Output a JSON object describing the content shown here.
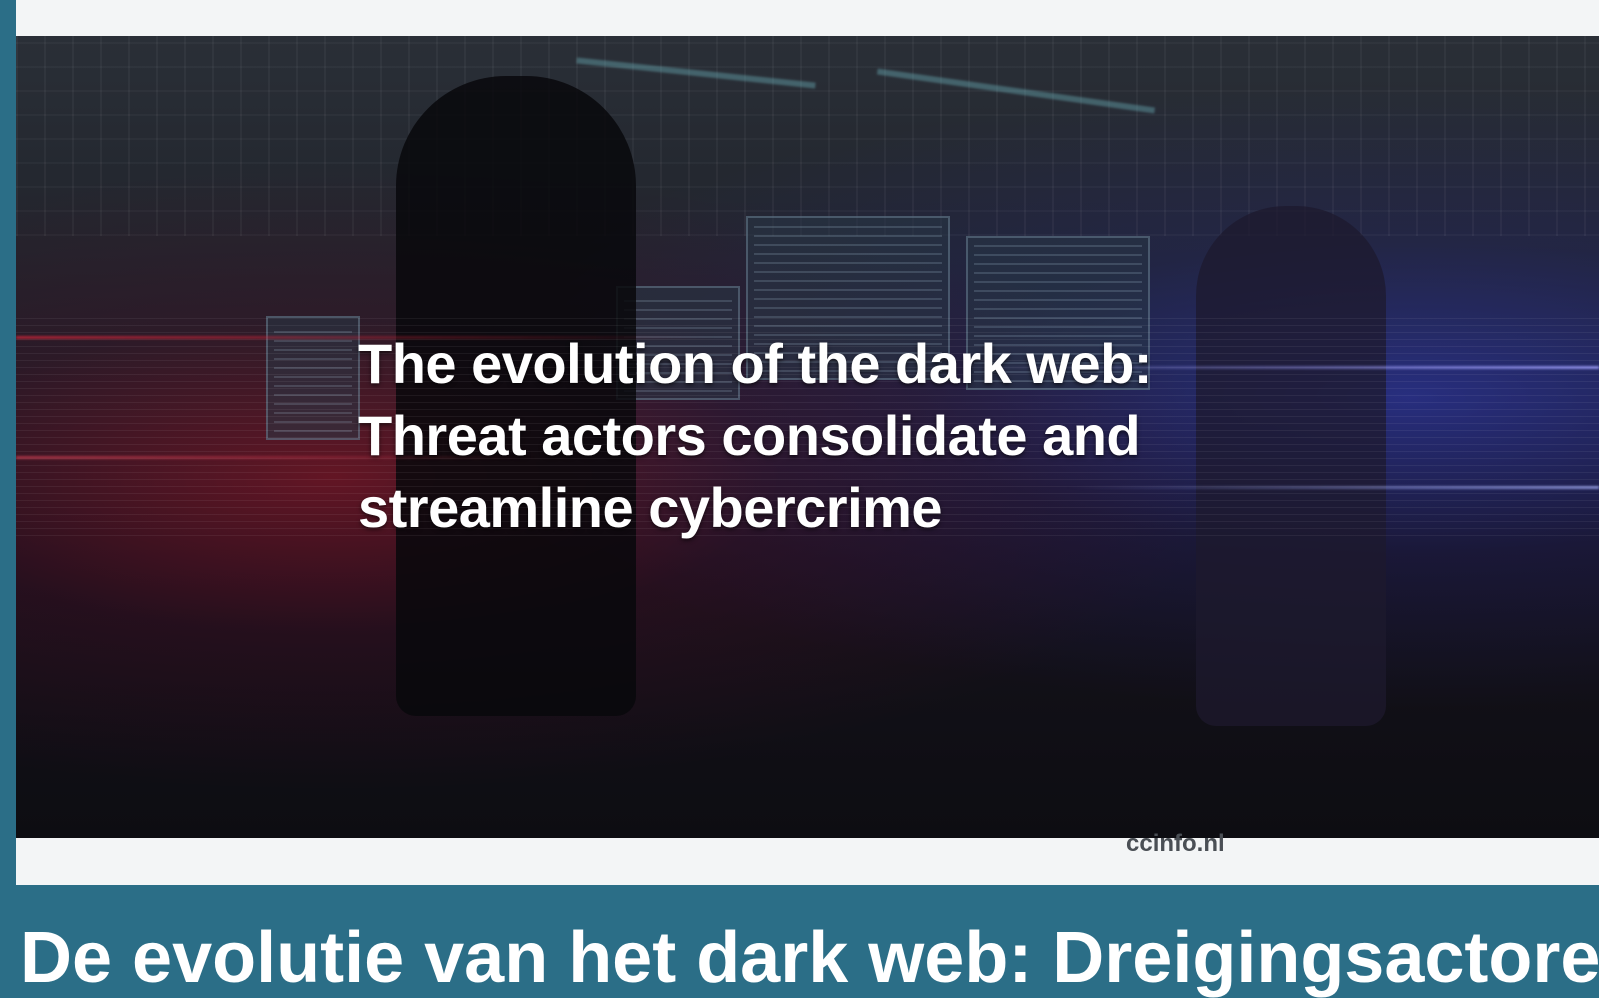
{
  "hero": {
    "headline_lines": [
      "The evolution of the dark web:",
      "Threat actors consolidate and",
      "streamline cybercrime"
    ]
  },
  "source_domain": "ccinfo.nl",
  "article": {
    "title_partial": "De evolutie van het dark web: Dreigingsactoren"
  },
  "colors": {
    "page_background": "#2b6e87",
    "card_background": "#f3f5f6",
    "headline_text": "#ffffff",
    "domain_text": "#4a4f55"
  }
}
